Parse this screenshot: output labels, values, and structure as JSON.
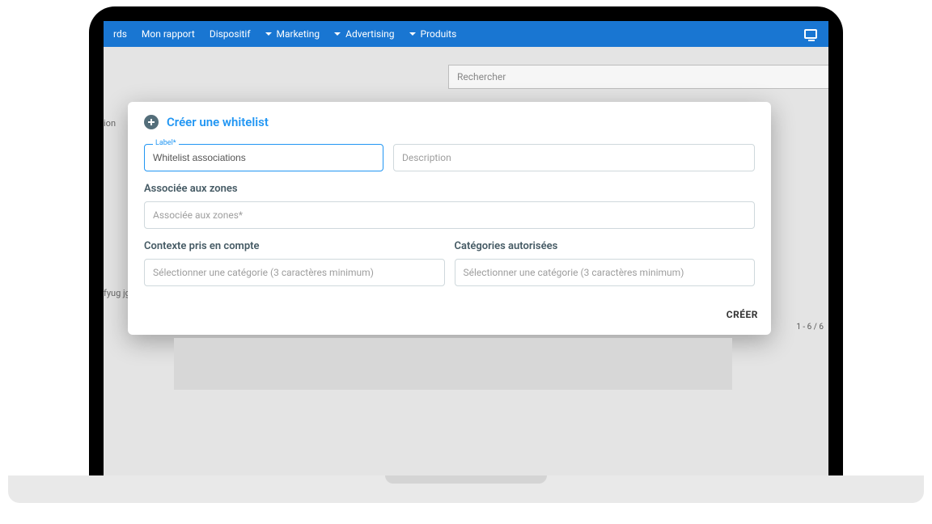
{
  "nav": {
    "item_rds": "rds",
    "item_rapport": "Mon rapport",
    "item_dispositif": "Dispositif",
    "item_marketing": "Marketing",
    "item_advertising": "Advertising",
    "item_produits": "Produits"
  },
  "background": {
    "search_placeholder": "Rechercher",
    "left1": "ion",
    "left2": "fyug jgg",
    "pager": "1 - 6 / 6"
  },
  "modal": {
    "title": "Créer une whitelist",
    "label_field_label": "Label*",
    "label_value": "Whitelist associations",
    "description_placeholder": "Description",
    "zones_heading": "Associée aux zones",
    "zones_placeholder": "Associée aux zones*",
    "contexte_heading": "Contexte pris en compte",
    "contexte_placeholder": "Sélectionner une catégorie (3 caractères minimum)",
    "categories_heading": "Catégories autorisées",
    "categories_placeholder": "Sélectionner une catégorie (3 caractères minimum)",
    "create_button": "CRÉER"
  }
}
